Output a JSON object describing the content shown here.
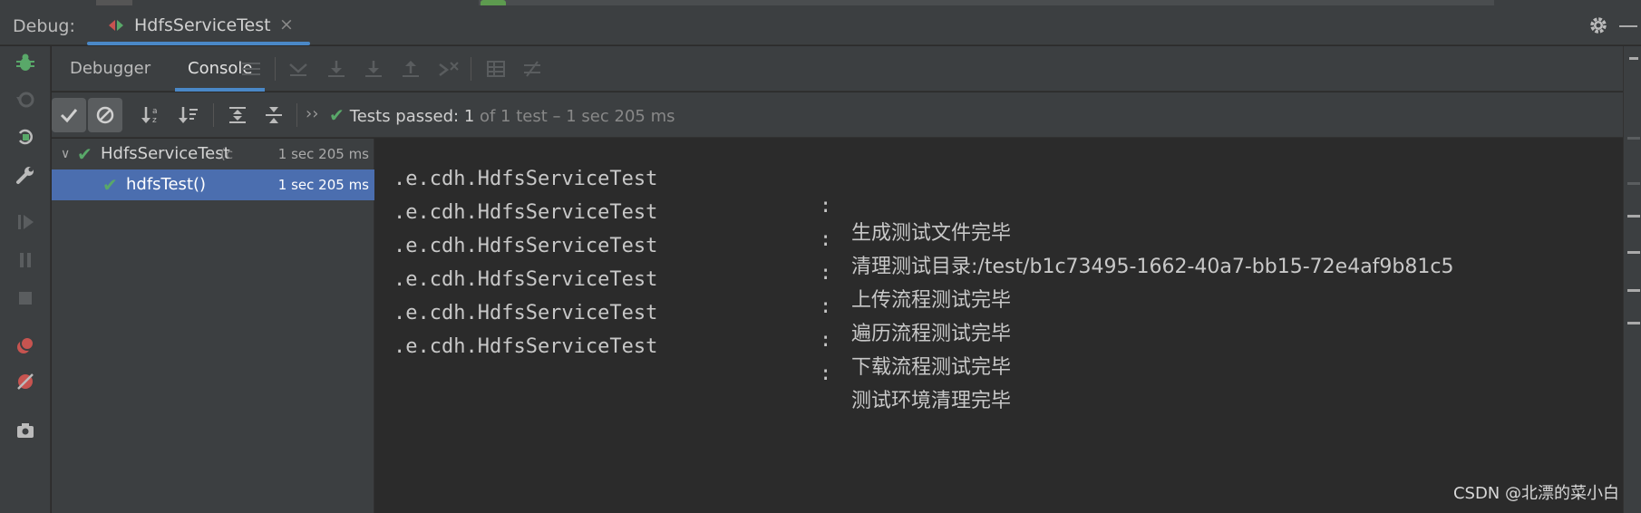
{
  "window": {
    "panel_label": "Debug:",
    "session_tab": "HdfsServiceTest",
    "close_glyph": "×"
  },
  "tabs": [
    {
      "label": "Debugger",
      "active": false
    },
    {
      "label": "Console",
      "active": true
    }
  ],
  "test_toolbar": {
    "more_glyph": "››",
    "status_prefix": "Tests passed: ",
    "status_count": "1",
    "status_suffix": " of 1 test – 1 sec 205 ms"
  },
  "test_tree": [
    {
      "name": "HdfsServiceTest",
      "suffix": "(c",
      "time": "1 sec 205 ms",
      "expanded": true,
      "selected": false
    },
    {
      "name": "hdfsTest()",
      "suffix": "",
      "time": "1 sec 205 ms",
      "selected": true
    }
  ],
  "console": {
    "lines": [
      {
        "cls": ".e.cdh.HdfsServiceTest",
        "colon": ":",
        "msg": "生成测试文件完毕"
      },
      {
        "cls": ".e.cdh.HdfsServiceTest",
        "colon": ":",
        "msg": "清理测试目录:/test/b1c73495-1662-40a7-bb15-72e4af9b81c5"
      },
      {
        "cls": ".e.cdh.HdfsServiceTest",
        "colon": ":",
        "msg": "上传流程测试完毕"
      },
      {
        "cls": ".e.cdh.HdfsServiceTest",
        "colon": ":",
        "msg": "遍历流程测试完毕"
      },
      {
        "cls": ".e.cdh.HdfsServiceTest",
        "colon": ":",
        "msg": "下载流程测试完毕"
      },
      {
        "cls": ".e.cdh.HdfsServiceTest",
        "colon": ":",
        "msg": "测试环境清理完毕"
      }
    ]
  },
  "watermark": "CSDN @北漂的菜小白",
  "colors": {
    "accent": "#4a88c7",
    "success": "#59a869",
    "selection": "#4b6eaf",
    "background": "#2b2b2b",
    "panel": "#3c3f41"
  }
}
